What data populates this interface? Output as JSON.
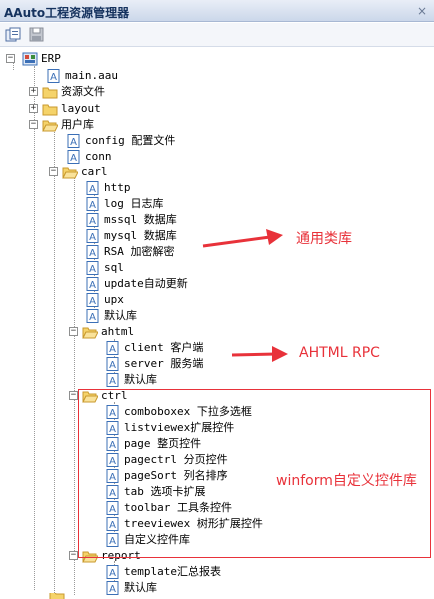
{
  "window": {
    "title": "AAuto工程资源管理器",
    "close_glyph": "×"
  },
  "toolbar": {
    "buttons": [
      {
        "name": "open-project-icon"
      },
      {
        "name": "save-icon"
      }
    ]
  },
  "tree": {
    "root": "ERP",
    "main": "main.aau",
    "resources": "资源文件",
    "layout": "layout",
    "userlib": "用户库",
    "config": "config 配置文件",
    "conn": "conn",
    "carl": "carl",
    "carl_items": [
      "http",
      "log 日志库",
      "mssql 数据库",
      "mysql 数据库",
      "RSA 加密解密",
      "sql",
      "update自动更新",
      "upx",
      "默认库"
    ],
    "ahtml": "ahtml",
    "ahtml_items": [
      "client 客户端",
      "server 服务端",
      "默认库"
    ],
    "ctrl": "ctrl",
    "ctrl_items": [
      "comboboxex 下拉多选框",
      "listviewex扩展控件",
      "page 整页控件",
      "pagectrl 分页控件",
      "pageSort 列名排序",
      "tab 选项卡扩展",
      "toolbar 工具条控件",
      "treeviewex 树形扩展控件",
      "自定义控件库"
    ],
    "report": "report",
    "report_items": [
      "template汇总报表",
      "默认库"
    ]
  },
  "annotations": {
    "common_libs": "通用类库",
    "ahtml_rpc": "AHTML RPC",
    "winform": "winform自定义控件库"
  },
  "colors": {
    "annotation": "#e8323a",
    "folder": "#f5d36a",
    "file_border": "#3b6fb6"
  }
}
